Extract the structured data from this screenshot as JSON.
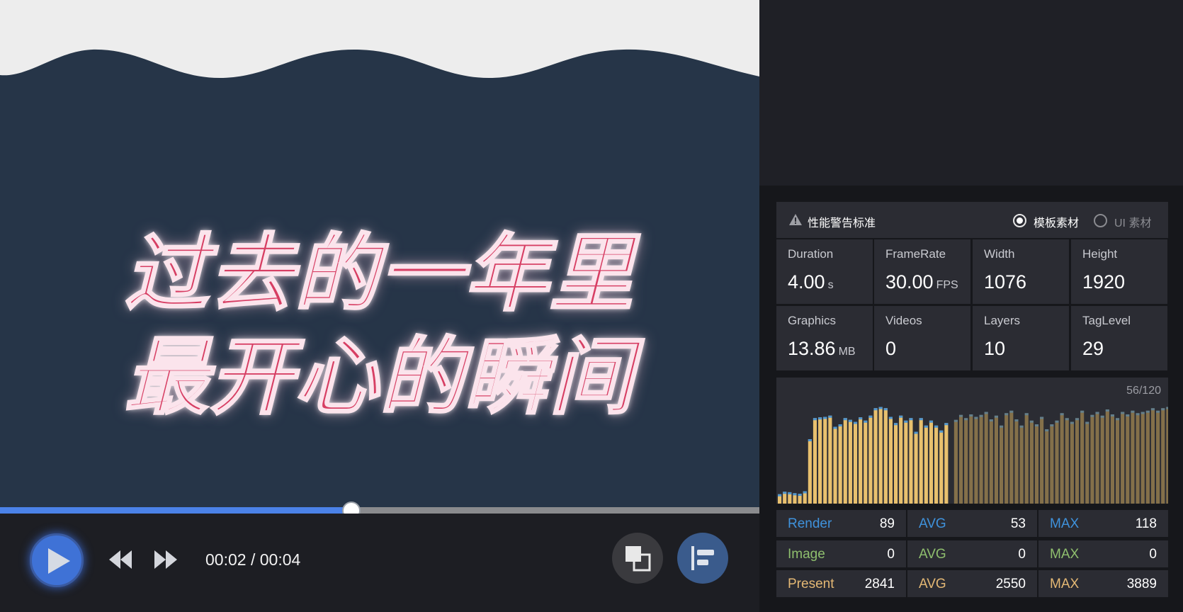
{
  "preview": {
    "headline_line1": "过去的一年里",
    "headline_line2": "最开心的瞬间",
    "colors": {
      "background": "#263548",
      "wave": "#ededed",
      "text": "#d73e63"
    }
  },
  "player": {
    "progress": 0.463,
    "current_time": "00:02",
    "total_time": "00:04",
    "time_separator": " / ",
    "accent_color": "#4b82e8",
    "icons": [
      "play-icon",
      "rewind-icon",
      "fast-forward-icon",
      "layers-icon",
      "align-left-icon"
    ]
  },
  "panel": {
    "warning_title": "性能警告标准",
    "radio_options": [
      {
        "label": "模板素材",
        "selected": true
      },
      {
        "label": "UI 素材",
        "selected": false
      }
    ],
    "stats": [
      {
        "label": "Duration",
        "value": "4.00",
        "unit": "s"
      },
      {
        "label": "FrameRate",
        "value": "30.00",
        "unit": "FPS"
      },
      {
        "label": "Width",
        "value": "1076",
        "unit": ""
      },
      {
        "label": "Height",
        "value": "1920",
        "unit": ""
      },
      {
        "label": "Graphics",
        "value": "13.86",
        "unit": "MB"
      },
      {
        "label": "Videos",
        "value": "0",
        "unit": ""
      },
      {
        "label": "Layers",
        "value": "10",
        "unit": ""
      },
      {
        "label": "TagLevel",
        "value": "29",
        "unit": ""
      }
    ],
    "chart_counter": "56/120",
    "metrics": [
      {
        "label": "Render",
        "value": "89",
        "avg_label": "AVG",
        "avg": "53",
        "max_label": "MAX",
        "max": "118",
        "color": "#3f92dc"
      },
      {
        "label": "Image",
        "value": "0",
        "avg_label": "AVG",
        "avg": "0",
        "max_label": "MAX",
        "max": "0",
        "color": "#8fbf6e"
      },
      {
        "label": "Present",
        "value": "2841",
        "avg_label": "AVG",
        "avg": "2550",
        "max_label": "MAX",
        "max": "3889",
        "color": "#e4b874"
      }
    ]
  },
  "chart_data": {
    "type": "bar",
    "ylim": [
      0,
      4000
    ],
    "current_frames": 56,
    "total_frames": 120,
    "values": [
      380,
      480,
      460,
      420,
      400,
      500,
      2600,
      3450,
      3480,
      3500,
      3550,
      3100,
      3200,
      3450,
      3380,
      3300,
      3480,
      3350,
      3550,
      3850,
      3900,
      3850,
      3500,
      3250,
      3550,
      3350,
      3450,
      2900,
      3450,
      3150,
      3350,
      3150,
      2950,
      3250,
      3380,
      3580,
      3450,
      3600,
      3500,
      3580,
      3700,
      3400,
      3550,
      3150,
      3650,
      3750,
      3400,
      3150,
      3650,
      3350,
      3200,
      3500,
      3000,
      3200,
      3350,
      3650,
      3450,
      3300,
      3450,
      3750,
      3300,
      3580,
      3700,
      3550,
      3800,
      3600,
      3450,
      3700,
      3600,
      3750,
      3650,
      3700,
      3750,
      3850,
      3750,
      3850,
      3900
    ],
    "colors": {
      "played": "#e8c06e",
      "pending": "#84704a",
      "render": "#3f92dc"
    }
  }
}
